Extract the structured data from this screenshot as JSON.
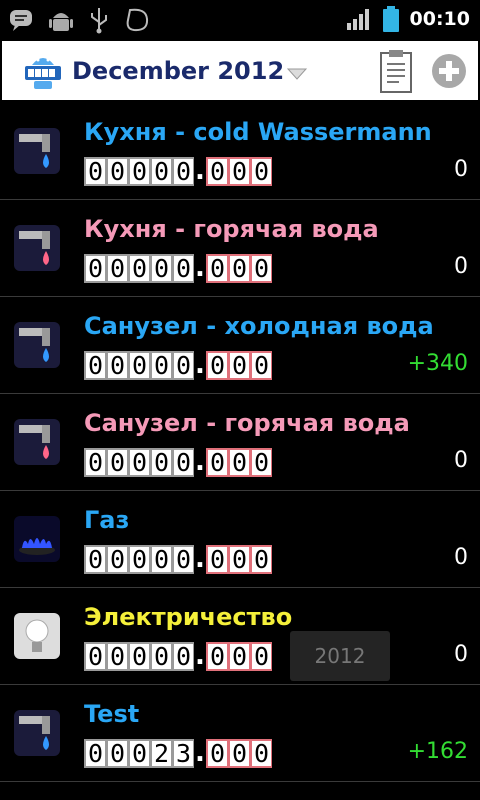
{
  "status_bar": {
    "icons_left": [
      "chat-icon",
      "android-debug-icon",
      "usb-icon",
      "tag-icon"
    ],
    "icons_right": [
      "signal-icon",
      "battery-icon"
    ],
    "time": "00:10"
  },
  "header": {
    "month": "December 2012",
    "actions": [
      "clipboard-icon",
      "add-icon"
    ]
  },
  "meters": [
    {
      "title": "Кухня - cold Wassermann",
      "color": "#2aa7f5",
      "icon": "faucet-cold-icon",
      "integer": [
        "0",
        "0",
        "0",
        "0",
        "0"
      ],
      "decimal": [
        "0",
        "0",
        "0"
      ],
      "delta": "0",
      "positive": false
    },
    {
      "title": "Кухня - горячая вода",
      "color": "#f59ab8",
      "icon": "faucet-hot-icon",
      "integer": [
        "0",
        "0",
        "0",
        "0",
        "0"
      ],
      "decimal": [
        "0",
        "0",
        "0"
      ],
      "delta": "0",
      "positive": false
    },
    {
      "title": "Санузел - холодная вода",
      "color": "#2aa7f5",
      "icon": "faucet-cold-icon",
      "integer": [
        "0",
        "0",
        "0",
        "0",
        "0"
      ],
      "decimal": [
        "0",
        "0",
        "0"
      ],
      "delta": "+340",
      "positive": true
    },
    {
      "title": "Санузел - горячая вода",
      "color": "#f59ab8",
      "icon": "faucet-hot-icon",
      "integer": [
        "0",
        "0",
        "0",
        "0",
        "0"
      ],
      "decimal": [
        "0",
        "0",
        "0"
      ],
      "delta": "0",
      "positive": false
    },
    {
      "title": "Газ",
      "color": "#2aa7f5",
      "icon": "gas-flame-icon",
      "integer": [
        "0",
        "0",
        "0",
        "0",
        "0"
      ],
      "decimal": [
        "0",
        "0",
        "0"
      ],
      "delta": "0",
      "positive": false
    },
    {
      "title": "Электричество",
      "color": "#f5f03a",
      "icon": "light-bulb-icon",
      "integer": [
        "0",
        "0",
        "0",
        "0",
        "0"
      ],
      "decimal": [
        "0",
        "0",
        "0"
      ],
      "delta": "0",
      "positive": false
    },
    {
      "title": "Test",
      "color": "#2aa7f5",
      "icon": "faucet-cold-icon",
      "integer": [
        "0",
        "0",
        "0",
        "2",
        "3"
      ],
      "decimal": [
        "0",
        "0",
        "0"
      ],
      "delta": "+162",
      "positive": true
    }
  ],
  "toast": {
    "text": "2012"
  }
}
